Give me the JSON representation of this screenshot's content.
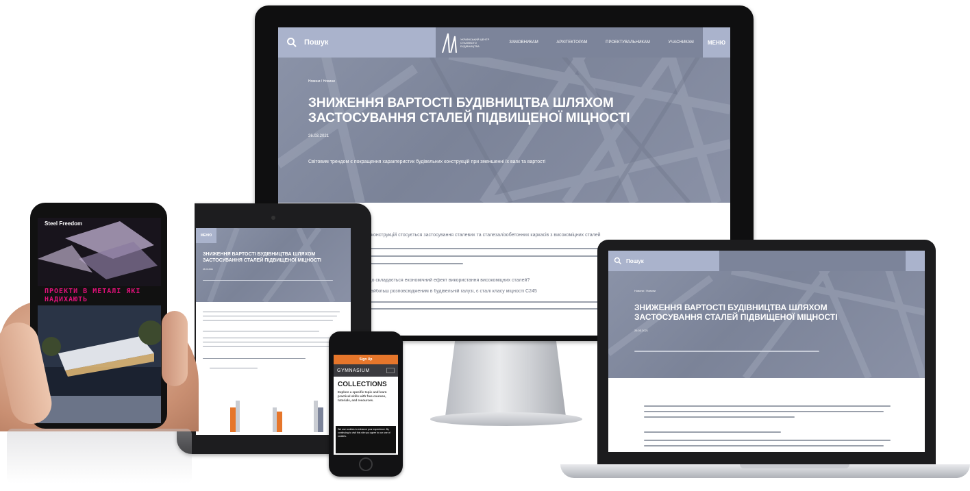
{
  "desktop": {
    "search_label": "Пошук",
    "logo_text": "УКРАЇНСЬКИЙ ЦЕНТР СТАЛЕВОГО БУДІВНИЦТВА",
    "nav": [
      "ЗАМОВНИКАМ",
      "АРХІТЕКТОРАМ",
      "ПРОЕКТУВАЛЬНИКАМ",
      "УЧАСНИКАМ"
    ],
    "menu_label": "МЕНЮ",
    "breadcrumb": "Новини / Новини",
    "title": "ЗНИЖЕННЯ ВАРТОСТІ БУДІВНИЦТВА ШЛЯХОМ ЗАСТОСУВАННЯ СТАЛЕЙ ПІДВИЩЕНОЇ МІЦНОСТІ",
    "date": "26.03.2021",
    "lead": "Світовим трендом є покращення характеристик будівельних конструкцій при зменшенні їх ваги та вартості",
    "body_1": "...конструкцій стосується застосування сталевих та сталезалізобетонних каркасів з високоміцних сталей",
    "body_2": "Що складається економічний ефект використання високоміцних сталей?",
    "body_3": "Найбільш розповсюдженим в будівельній галузі, є сталі класу міцності С245"
  },
  "tablet": {
    "menu_label": "МЕНЮ",
    "title": "ЗНИЖЕННЯ ВАРТОСТІ БУДІВНИЦТВА ШЛЯХОМ ЗАСТОСУВАННЯ СТАЛЕЙ ПІДВИЩЕНОЇ МІЦНОСТІ",
    "date": "26.03.2021"
  },
  "laptop": {
    "search_label": "Пошук",
    "breadcrumb": "Новини / Новини",
    "title": "ЗНИЖЕННЯ ВАРТОСТІ БУДІВНИЦТВА ШЛЯХОМ ЗАСТОСУВАННЯ СТАЛЕЙ ПІДВИЩЕНОЇ МІЦНОСТІ",
    "date": "26.03.2021"
  },
  "iphone": {
    "signup_label": "Sign Up",
    "brand": "GYMNASIUM",
    "heading": "COLLECTIONS",
    "text": "Explore a specific topic and learn practical skills with free courses, tutorials, and resources.",
    "cookie_text": "We use cookies to enhance your experience. By continuing to visit this site you agree to our use of cookies."
  },
  "android": {
    "brand": "Steel Freedom",
    "headline": "ПРОЕКТИ В МЕТАЛІ ЯКІ НАДИХАЮТЬ"
  },
  "colors": {
    "hero": "#868ea3",
    "nav_bar": "#aab3cc",
    "accent_orange": "#e6762b",
    "accent_pink": "#e0117a",
    "device_black": "#111111"
  }
}
